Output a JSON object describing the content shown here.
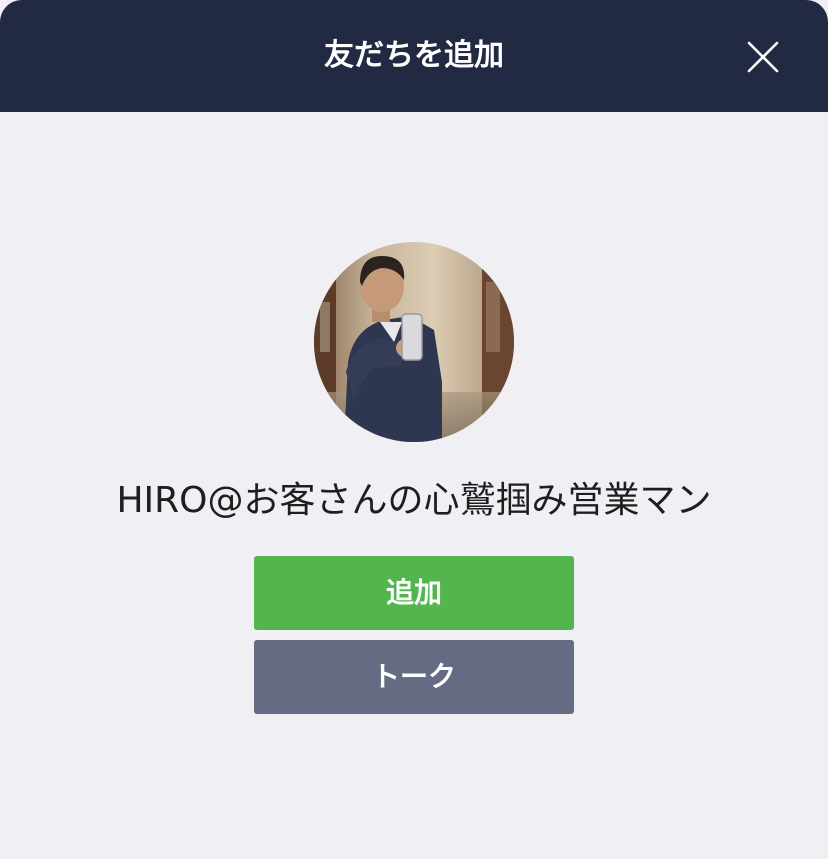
{
  "header": {
    "title": "友だちを追加",
    "close_icon": "close-icon"
  },
  "profile": {
    "avatar_icon": "avatar-photo",
    "name": "HIRO@お客さんの心鷲掴み営業マン"
  },
  "actions": {
    "add_label": "追加",
    "talk_label": "トーク"
  },
  "colors": {
    "header_bg": "#212a42",
    "page_bg": "#efeff4",
    "add_button": "#53b54e",
    "talk_button": "#646b82",
    "name_text": "#1e1e1e"
  }
}
